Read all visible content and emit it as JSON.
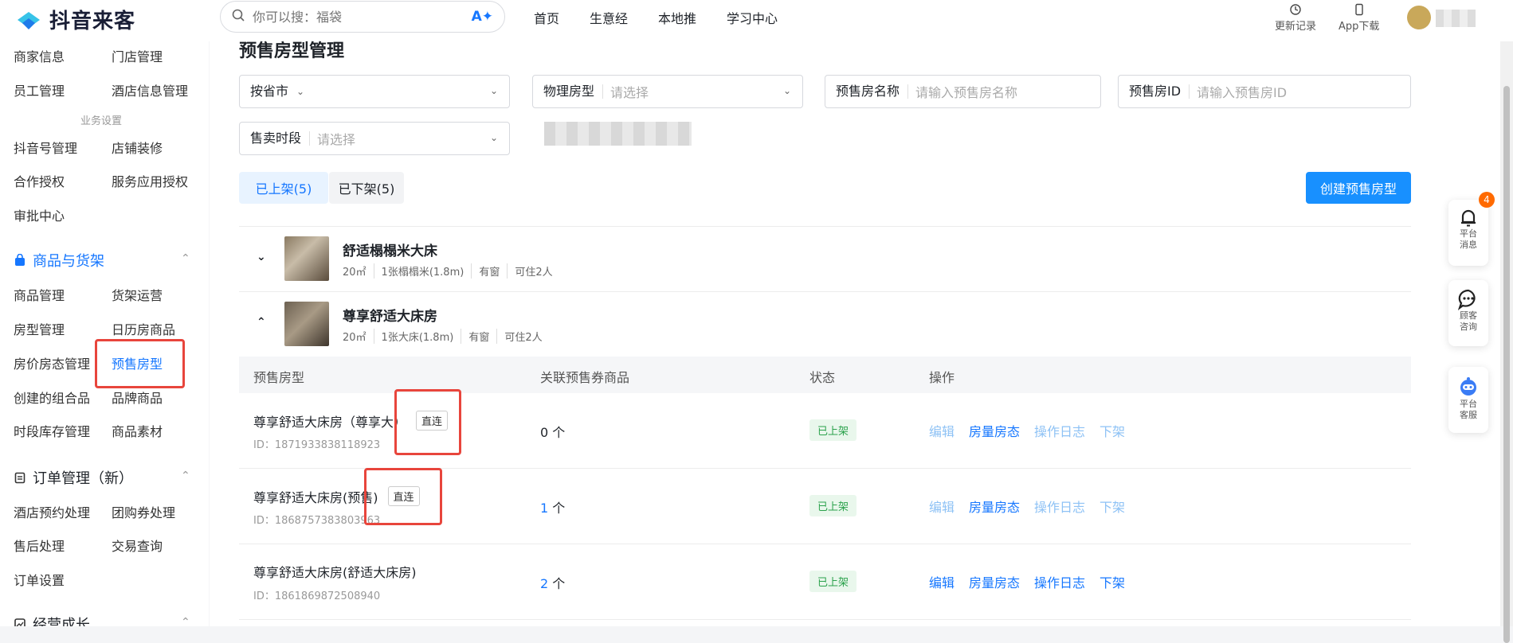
{
  "app": {
    "logo_text": "抖音来客"
  },
  "search": {
    "placeholder": "你可以搜：福袋",
    "ai_label": "A✦"
  },
  "topnav": [
    "首页",
    "生意经",
    "本地推",
    "学习中心"
  ],
  "topright": {
    "update_log": "更新记录",
    "app_download": "App下载"
  },
  "sidebar": {
    "row1": [
      "商家信息",
      "门店管理"
    ],
    "row2": [
      "员工管理",
      "酒店信息管理"
    ],
    "section_label": "业务设置",
    "row3": [
      "抖音号管理",
      "店铺装修"
    ],
    "row4": [
      "合作授权",
      "服务应用授权"
    ],
    "row5": [
      "审批中心"
    ],
    "group_goods": "商品与货架",
    "row6": [
      "商品管理",
      "货架运营"
    ],
    "row7": [
      "房型管理",
      "日历房商品"
    ],
    "row8": [
      "房价房态管理",
      "预售房型"
    ],
    "row9": [
      "创建的组合品",
      "品牌商品"
    ],
    "row10": [
      "时段库存管理",
      "商品素材"
    ],
    "group_orders": "订单管理（新）",
    "row11": [
      "酒店预约处理",
      "团购券处理"
    ],
    "row12": [
      "售后处理",
      "交易查询"
    ],
    "row13": [
      "订单设置"
    ],
    "group_growth": "经营成长"
  },
  "page": {
    "title": "预售房型管理"
  },
  "filters": {
    "province_label": "按省市",
    "physical_label": "物理房型",
    "physical_ph": "请选择",
    "name_label": "预售房名称",
    "name_ph": "请输入预售房名称",
    "id_label": "预售房ID",
    "id_ph": "请输入预售房ID",
    "period_label": "售卖时段",
    "period_ph": "请选择"
  },
  "tabs": {
    "listed": "已上架(5)",
    "unlisted": "已下架(5)"
  },
  "create_button": "创建预售房型",
  "rooms": [
    {
      "title": "舒适榻榻米大床",
      "area": "20㎡",
      "bed": "1张榻榻米(1.8m)",
      "window": "有窗",
      "capacity": "可住2人",
      "toggle": "⌄"
    },
    {
      "title": "尊享舒适大床房",
      "area": "20㎡",
      "bed": "1张大床(1.8m)",
      "window": "有窗",
      "capacity": "可住2人",
      "toggle": "⌃"
    }
  ],
  "table": {
    "headers": [
      "预售房型",
      "关联预售券商品",
      "状态",
      "操作"
    ],
    "rows": [
      {
        "name": "尊享舒适大床房（尊享大）",
        "tag": "直连",
        "id": "ID：1871933838118923",
        "count_num": "0",
        "count_unit": " 个",
        "status": "已上架",
        "ops": [
          "编辑",
          "房量房态",
          "操作日志",
          "下架"
        ]
      },
      {
        "name": "尊享舒适大床房(预售)",
        "tag": "直连",
        "id": "ID：1868757383803963",
        "count_num": "1",
        "count_unit": " 个",
        "status": "已上架",
        "ops": [
          "编辑",
          "房量房态",
          "操作日志",
          "下架"
        ]
      },
      {
        "name": "尊享舒适大床房(舒适大床房)",
        "tag": "",
        "id": "ID：1861869872508940",
        "count_num": "2",
        "count_unit": " 个",
        "status": "已上架",
        "ops": [
          "编辑",
          "房量房态",
          "操作日志",
          "下架"
        ]
      }
    ]
  },
  "float": {
    "messages": "平台消息",
    "messages_badge": "4",
    "customer": "顾客咨询",
    "service": "平台客服"
  },
  "colors": {
    "accent": "#1677ff",
    "button": "#1890ff",
    "highlight_box": "#e8453c",
    "status_green": "#2ba24c",
    "badge": "#ff6a00"
  }
}
